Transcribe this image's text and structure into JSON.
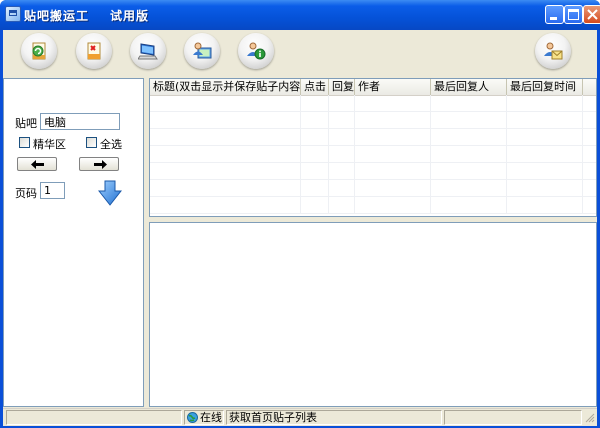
{
  "window": {
    "title": "贴吧搬运工",
    "edition": "试用版"
  },
  "toolbar": {
    "buttons": [
      {
        "name": "refresh-button",
        "icon": "refresh-document-icon"
      },
      {
        "name": "delete-button",
        "icon": "delete-document-icon"
      },
      {
        "name": "computer-button",
        "icon": "computer-icon"
      },
      {
        "name": "user-monitor-button",
        "icon": "user-monitor-icon"
      },
      {
        "name": "info-button",
        "icon": "info-user-icon"
      },
      {
        "name": "mail-button",
        "icon": "user-mail-icon"
      }
    ]
  },
  "left_panel": {
    "tieba_label": "贴吧",
    "tieba_value": "电脑",
    "jinghua_label": "精华区",
    "select_all_label": "全选",
    "page_label": "页码",
    "page_value": "1"
  },
  "grid": {
    "columns": [
      "标题(双击显示并保存贴子内容)",
      "点击",
      "回复",
      "作者",
      "最后回复人",
      "最后回复时间"
    ]
  },
  "status": {
    "online": "在线",
    "message": "获取首页贴子列表"
  },
  "colors": {
    "titlebar": "#0552d8",
    "face": "#ece9d8",
    "border": "#7f9db9",
    "accent_arrow": "#3a8de0"
  }
}
